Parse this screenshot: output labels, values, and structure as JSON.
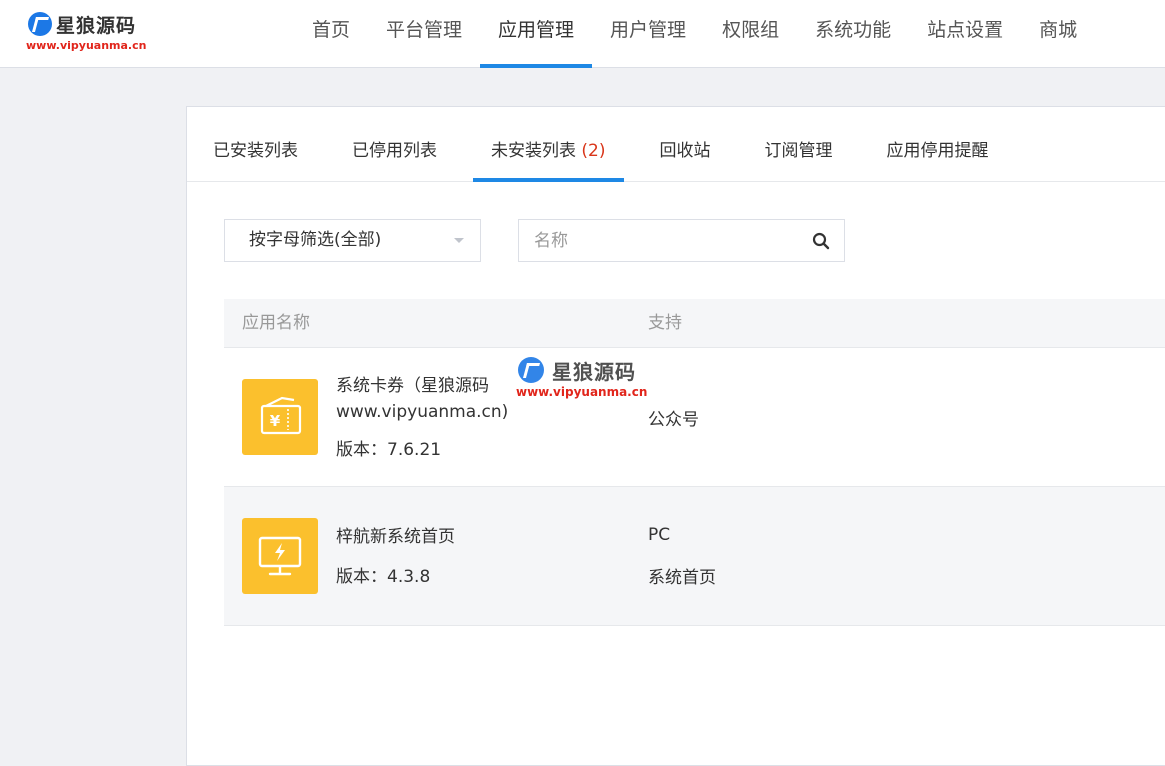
{
  "header": {
    "logo_text": "星狼源码",
    "logo_url": "www.vipyuanma.cn",
    "nav": [
      {
        "label": "首页",
        "name": "nav-home"
      },
      {
        "label": "平台管理",
        "name": "nav-platform"
      },
      {
        "label": "应用管理",
        "name": "nav-apps",
        "active": true
      },
      {
        "label": "用户管理",
        "name": "nav-users"
      },
      {
        "label": "权限组",
        "name": "nav-permissions"
      },
      {
        "label": "系统功能",
        "name": "nav-system"
      },
      {
        "label": "站点设置",
        "name": "nav-site"
      },
      {
        "label": "商城",
        "name": "nav-store"
      }
    ]
  },
  "tabs": [
    {
      "label": "已安装列表",
      "count": ""
    },
    {
      "label": "已停用列表",
      "count": ""
    },
    {
      "label": "未安装列表",
      "count": "(2)",
      "active": true
    },
    {
      "label": "回收站",
      "count": ""
    },
    {
      "label": "订阅管理",
      "count": ""
    },
    {
      "label": "应用停用提醒",
      "count": ""
    }
  ],
  "filter": {
    "selected": "按字母筛选(全部)"
  },
  "search": {
    "placeholder": "名称",
    "value": ""
  },
  "table": {
    "columns": [
      "应用名称",
      "支持"
    ],
    "rows": [
      {
        "name": "系统卡券（星狼源码www.vipyuanma.cn)",
        "version": "版本：7.6.21",
        "support": [
          "公众号"
        ],
        "icon": "coupon-icon"
      },
      {
        "name": "梓航新系统首页",
        "version": "版本：4.3.8",
        "support": [
          "PC",
          "系统首页"
        ],
        "icon": "monitor-icon"
      }
    ]
  },
  "watermark": {
    "text": "星狼源码",
    "url": "www.vipyuanma.cn"
  },
  "colors": {
    "accent": "#1e88e5",
    "count": "#d9361a",
    "app_icon_bg": "#fbc02d"
  }
}
